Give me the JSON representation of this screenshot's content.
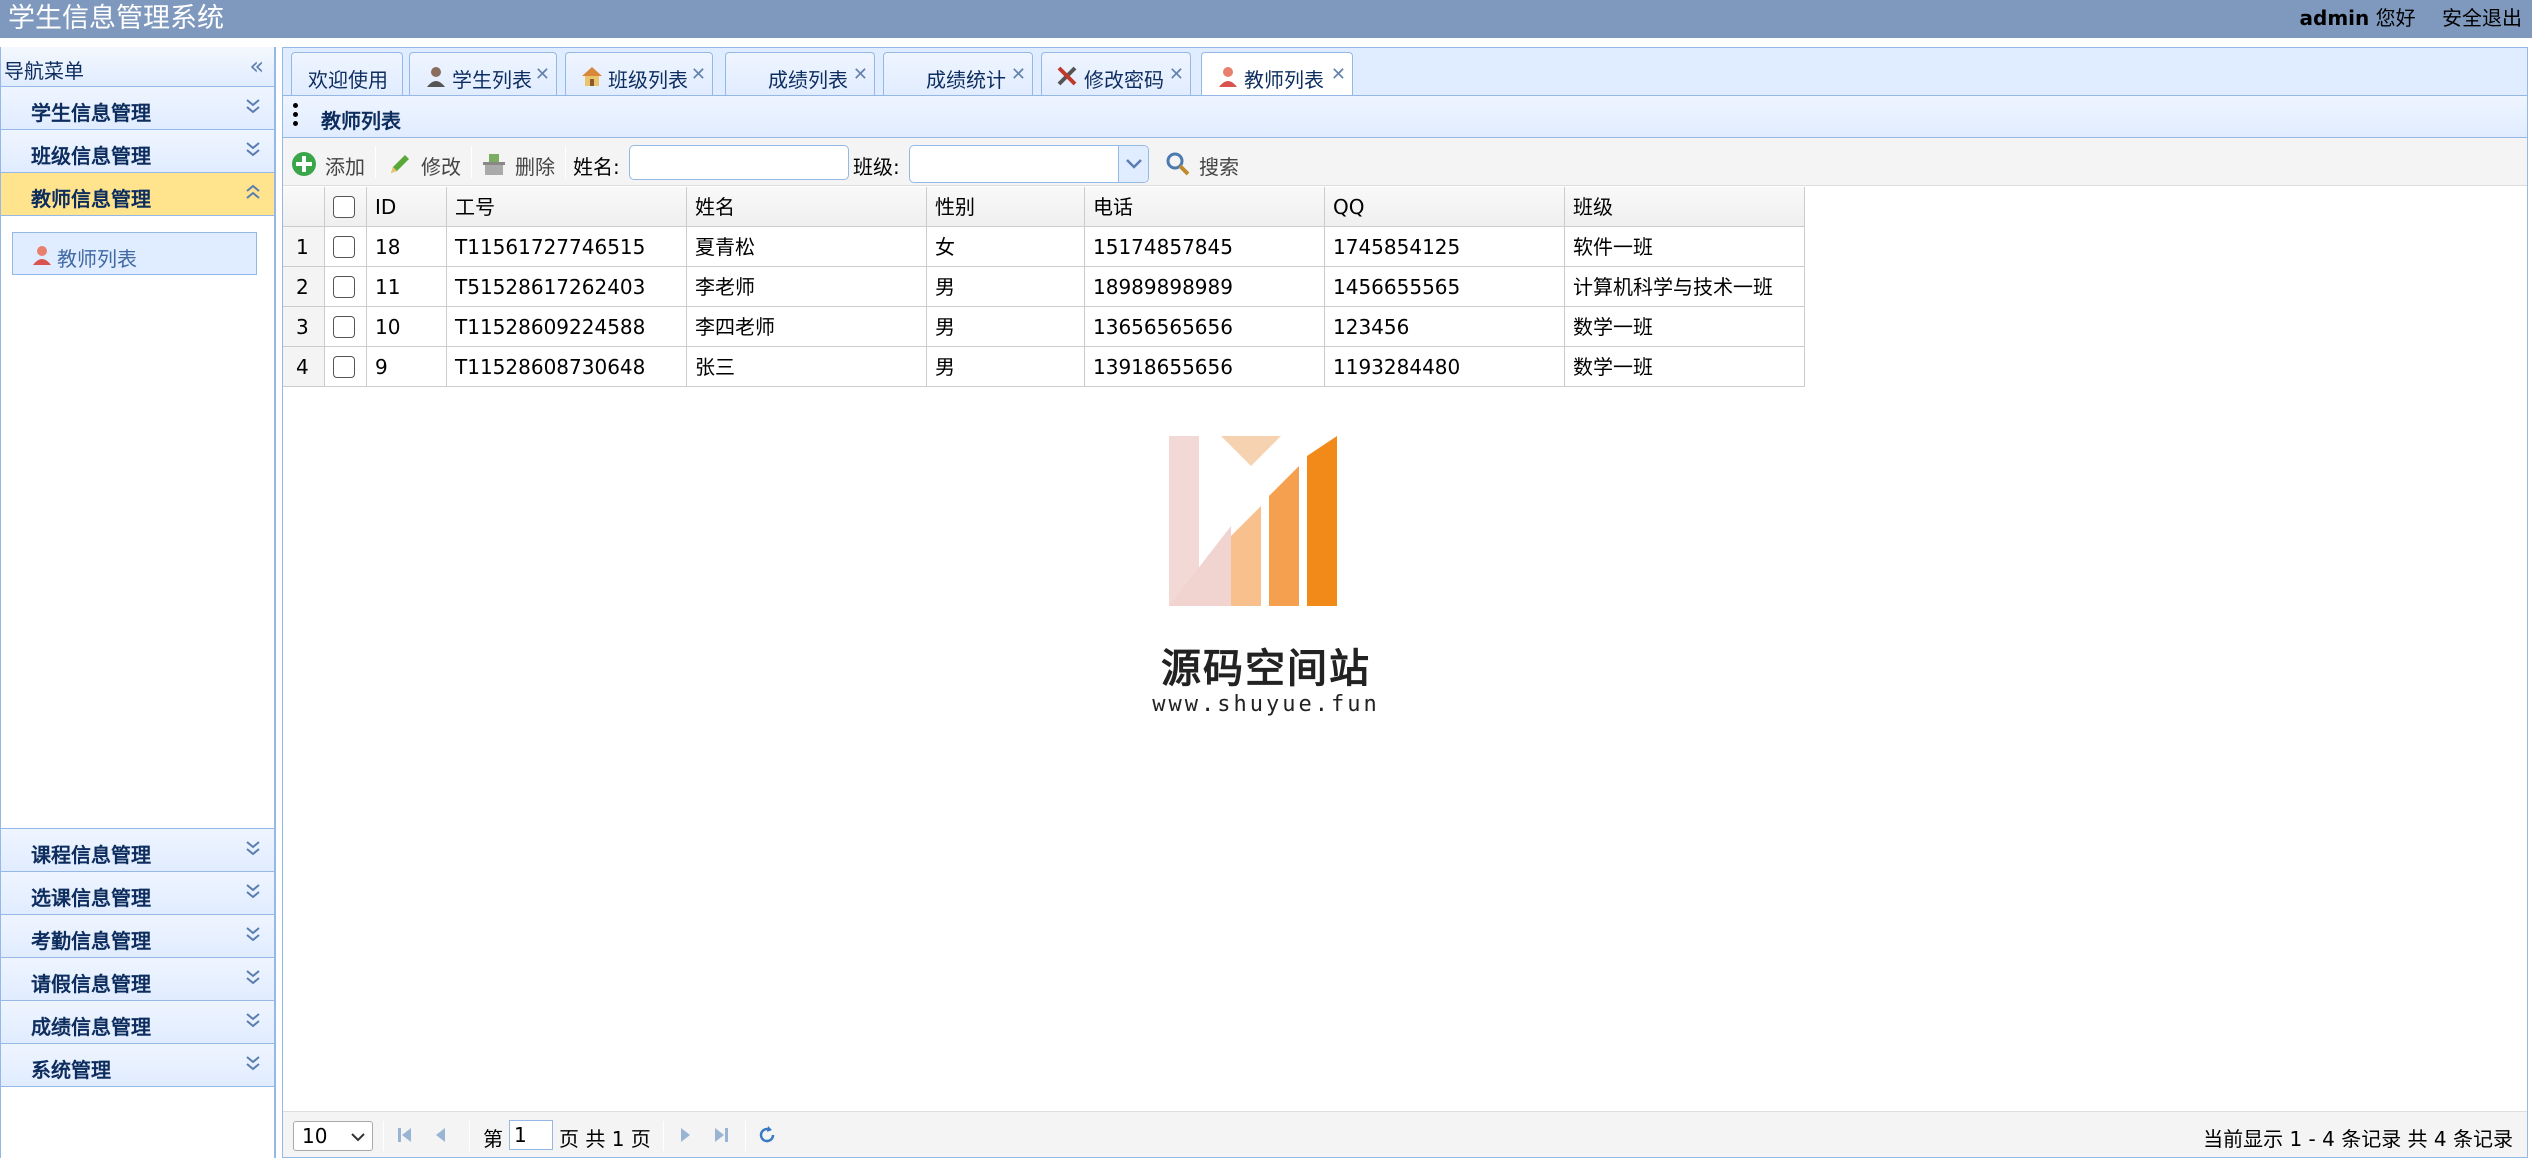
{
  "header": {
    "title": "学生信息管理系统",
    "user": "admin",
    "greeting": "您好",
    "logout": "安全退出"
  },
  "sidebar": {
    "title": "导航菜单",
    "menus_top": [
      {
        "label": "学生信息管理"
      },
      {
        "label": "班级信息管理"
      },
      {
        "label": "教师信息管理"
      }
    ],
    "active_link": "教师列表",
    "menus_bottom": [
      {
        "label": "课程信息管理"
      },
      {
        "label": "选课信息管理"
      },
      {
        "label": "考勤信息管理"
      },
      {
        "label": "请假信息管理"
      },
      {
        "label": "成绩信息管理"
      },
      {
        "label": "系统管理"
      }
    ]
  },
  "tabs": [
    {
      "label": "欢迎使用",
      "icon": "none"
    },
    {
      "label": "学生列表",
      "icon": "user-icon"
    },
    {
      "label": "班级列表",
      "icon": "house-icon"
    },
    {
      "label": "成绩列表",
      "icon": "none"
    },
    {
      "label": "成绩统计",
      "icon": "none"
    },
    {
      "label": "修改密码",
      "icon": "tools-icon"
    },
    {
      "label": "教师列表",
      "icon": "teacher-icon"
    }
  ],
  "panel": {
    "title": "教师列表"
  },
  "toolbar": {
    "add": "添加",
    "edit": "修改",
    "delete": "删除",
    "name_label": "姓名:",
    "name_value": "",
    "class_label": "班级:",
    "class_value": "",
    "search": "搜索"
  },
  "grid": {
    "columns": [
      "ID",
      "工号",
      "姓名",
      "性别",
      "电话",
      "QQ",
      "班级"
    ],
    "rows": [
      {
        "num": "1",
        "id": "18",
        "sn": "T11561727746515",
        "name": "夏青松",
        "sex": "女",
        "phone": "15174857845",
        "qq": "1745854125",
        "clazz": "软件一班"
      },
      {
        "num": "2",
        "id": "11",
        "sn": "T51528617262403",
        "name": "李老师",
        "sex": "男",
        "phone": "18989898989",
        "qq": "1456655565",
        "clazz": "计算机科学与技术一班"
      },
      {
        "num": "3",
        "id": "10",
        "sn": "T11528609224588",
        "name": "李四老师",
        "sex": "男",
        "phone": "13656565656",
        "qq": "123456",
        "clazz": "数学一班"
      },
      {
        "num": "4",
        "id": "9",
        "sn": "T11528608730648",
        "name": "张三",
        "sex": "男",
        "phone": "13918655656",
        "qq": "1193284480",
        "clazz": "数学一班"
      }
    ]
  },
  "watermark": {
    "name": "源码空间站",
    "url": "www.shuyue.fun"
  },
  "pager": {
    "page_size": "10",
    "page_prefix": "第",
    "page_value": "1",
    "page_suffix": "页 共 1 页",
    "info": "当前显示 1 - 4 条记录 共 4 条记录"
  },
  "colors": {
    "header_bg": "#7f99be",
    "border": "#95b8e7",
    "active_menu": "#ffe48d",
    "tab_bg": "#e0ecff"
  }
}
